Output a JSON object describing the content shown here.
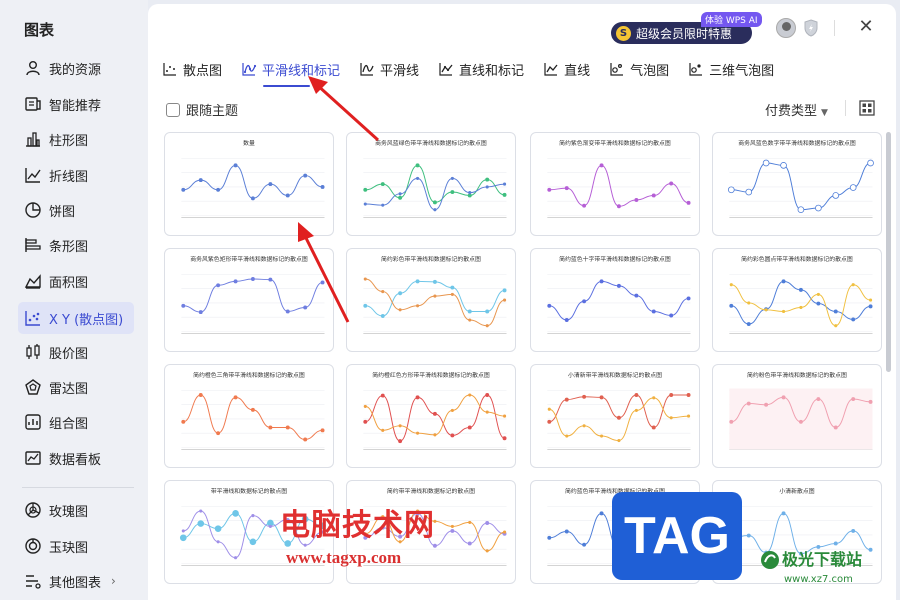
{
  "sidebar": {
    "title": "图表",
    "items": [
      {
        "label": "我的资源",
        "icon": "user-icon"
      },
      {
        "label": "智能推荐",
        "icon": "recommend-icon"
      },
      {
        "label": "柱形图",
        "icon": "column-chart-icon"
      },
      {
        "label": "折线图",
        "icon": "line-chart-icon"
      },
      {
        "label": "饼图",
        "icon": "pie-chart-icon"
      },
      {
        "label": "条形图",
        "icon": "bar-chart-icon"
      },
      {
        "label": "面积图",
        "icon": "area-chart-icon"
      },
      {
        "label": "X Y (散点图)",
        "icon": "scatter-chart-icon",
        "active": true
      },
      {
        "label": "股价图",
        "icon": "stock-chart-icon"
      },
      {
        "label": "雷达图",
        "icon": "radar-chart-icon"
      },
      {
        "label": "组合图",
        "icon": "combo-chart-icon"
      },
      {
        "label": "数据看板",
        "icon": "dashboard-icon"
      },
      {
        "label": "玫瑰图",
        "icon": "rose-chart-icon"
      },
      {
        "label": "玉玦图",
        "icon": "ring-chart-icon"
      },
      {
        "label": "其他图表",
        "icon": "other-chart-icon",
        "has_submenu": true
      }
    ]
  },
  "header": {
    "vip_badge": "体验 WPS AI",
    "vip_label": "超级会员限时特惠",
    "coin_symbol": "S"
  },
  "tabs": [
    {
      "label": "散点图",
      "icon": "scatter-icon"
    },
    {
      "label": "平滑线和标记",
      "icon": "smooth-marker-icon",
      "active": true
    },
    {
      "label": "平滑线",
      "icon": "smooth-line-icon"
    },
    {
      "label": "直线和标记",
      "icon": "straight-marker-icon"
    },
    {
      "label": "直线",
      "icon": "straight-line-icon"
    },
    {
      "label": "气泡图",
      "icon": "bubble-icon"
    },
    {
      "label": "三维气泡图",
      "icon": "bubble-3d-icon"
    }
  ],
  "toolbar": {
    "follow_theme": "跟随主题",
    "follow_theme_checked": false,
    "pay_type": "付费类型"
  },
  "templates": [
    {
      "title": "数量",
      "color": "#5b7fd6",
      "style": "basic"
    },
    {
      "title": "商务风蓝绿色带平滑线和数据标记的散点图",
      "color": "#3fbf7f",
      "color2": "#5b7fd6",
      "style": "two"
    },
    {
      "title": "简约紫色渐变带平滑线和数据标记的散点图",
      "color": "#b65fd6",
      "style": "purple"
    },
    {
      "title": "商务风蓝色数字带平滑线和数据标记的散点图",
      "color": "#4f7ed8",
      "style": "bubbles"
    },
    {
      "title": "商务风紫色矩形带平滑线和数据标记的散点图",
      "color": "#6f7ee0",
      "style": "rect"
    },
    {
      "title": "简约彩色带平滑线和数据标记的散点图",
      "color": "#6fc6e8",
      "color2": "#e8964f",
      "color3": "#9f8fe8",
      "style": "three"
    },
    {
      "title": "简约蓝色十字带平滑线和数据标记的散点图",
      "color": "#5b6fe0",
      "style": "cross"
    },
    {
      "title": "简约彩色圆点带平滑线和数据标记的散点图",
      "color": "#4f7ed8",
      "color2": "#f0c040",
      "style": "dots"
    },
    {
      "title": "简约橙色三角带平滑线和数据标记的散点图",
      "color": "#f07a4f",
      "style": "triangle"
    },
    {
      "title": "简约橙红色方形带平滑线和数据标记的散点图",
      "color": "#e05050",
      "color2": "#f0a040",
      "style": "square"
    },
    {
      "title": "小清新带平滑线和数据标记的散点图",
      "color": "#e06050",
      "color2": "#f0b040",
      "style": "fresh"
    },
    {
      "title": "简约粉色带平滑线和数据标记的散点图",
      "color": "#f0a0b0",
      "style": "pink"
    },
    {
      "title": "带平滑线和数据标记的散点图",
      "color": "#6fc6e8",
      "color2": "#9f8fe8",
      "style": "bubble2"
    },
    {
      "title": "简约带平滑线和数据标记的散点图",
      "color": "#9f8fe8",
      "color2": "#f0a040",
      "style": "simple"
    },
    {
      "title": "简约蓝色带平滑线和数据标记的散点图",
      "color": "#4f7ed8",
      "style": "blue"
    },
    {
      "title": "小清新散点图",
      "color": "#6fb0e8",
      "style": "fresh2"
    }
  ],
  "watermark": {
    "site_name": "电脑技术网",
    "site_url": "www.tagxp.com",
    "logo_text": "TAG",
    "brand": "极光下载站",
    "brand_url": "www.xz7.com"
  }
}
